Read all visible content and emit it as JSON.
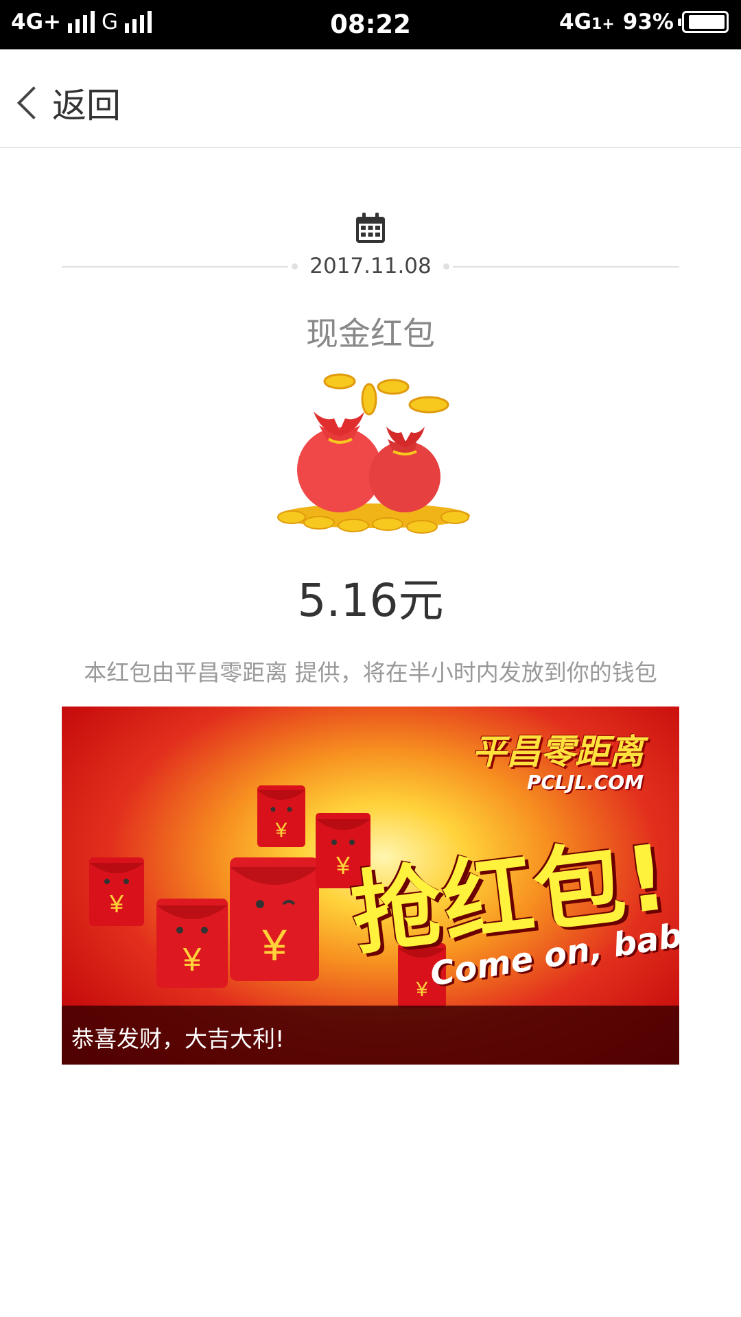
{
  "status_bar": {
    "network_left": "4G+",
    "network_secondary": "G",
    "time": "08:22",
    "network_right": "4G",
    "network_right_suffix": "1+",
    "battery_text": "93%",
    "battery_level": 0.93
  },
  "nav": {
    "back_label": "返回",
    "icons": {
      "back": "chevron-left-icon"
    }
  },
  "packet": {
    "date_icon": "calendar-icon",
    "date": "2017.11.08",
    "title": "现金红包",
    "illustration": "money-bags-icon",
    "amount": "5.16元",
    "notice": "本红包由平昌零距离 提供，将在半小时内发放到你的钱包"
  },
  "banner": {
    "brand_cn": "平昌零距离",
    "brand_en": "PCLJL.COM",
    "slogan": "抢红包!",
    "tagline": "Come on, baby!",
    "caption": "恭喜发财，大吉大利!"
  },
  "colors": {
    "status_bar_bg": "#000000",
    "text_dark": "#333333",
    "text_muted": "#999999",
    "banner_red": "#c80d0d",
    "banner_yellow": "#fff23c"
  }
}
